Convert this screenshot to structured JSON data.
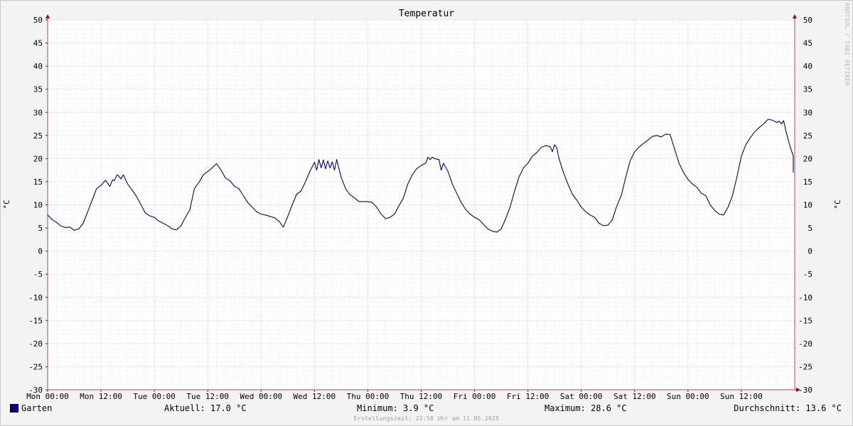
{
  "chart_data": {
    "type": "line",
    "title": "Temperatur",
    "ylabel": "°C",
    "ylim": [
      -30,
      50
    ],
    "yticks": [
      50,
      45,
      40,
      35,
      30,
      25,
      20,
      15,
      10,
      5,
      0,
      -5,
      -10,
      -15,
      -20,
      -25,
      -30
    ],
    "xlim": [
      0,
      168
    ],
    "x_unit": "hours since Mon 00:00",
    "xticks": [
      {
        "x": 0,
        "label": "Mon 00:00"
      },
      {
        "x": 12,
        "label": "Mon 12:00"
      },
      {
        "x": 24,
        "label": "Tue 00:00"
      },
      {
        "x": 36,
        "label": "Tue 12:00"
      },
      {
        "x": 48,
        "label": "Wed 00:00"
      },
      {
        "x": 60,
        "label": "Wed 12:00"
      },
      {
        "x": 72,
        "label": "Thu 00:00"
      },
      {
        "x": 84,
        "label": "Thu 12:00"
      },
      {
        "x": 96,
        "label": "Fri 00:00"
      },
      {
        "x": 108,
        "label": "Fri 12:00"
      },
      {
        "x": 120,
        "label": "Sat 00:00"
      },
      {
        "x": 132,
        "label": "Sat 12:00"
      },
      {
        "x": 144,
        "label": "Sun 00:00"
      },
      {
        "x": 156,
        "label": "Sun 12:00"
      }
    ],
    "grid": true,
    "series": [
      {
        "name": "Garten",
        "color": "#00008b",
        "points": [
          [
            0,
            7.8
          ],
          [
            1,
            6.8
          ],
          [
            2,
            6.2
          ],
          [
            3,
            5.4
          ],
          [
            4,
            5.1
          ],
          [
            5,
            5.2
          ],
          [
            6,
            4.5
          ],
          [
            7,
            4.8
          ],
          [
            8,
            6.0
          ],
          [
            9,
            8.5
          ],
          [
            10,
            11.0
          ],
          [
            11,
            13.5
          ],
          [
            12,
            14.2
          ],
          [
            13,
            15.3
          ],
          [
            14,
            14.0
          ],
          [
            14.6,
            15.4
          ],
          [
            15,
            15.2
          ],
          [
            15.6,
            16.5
          ],
          [
            16,
            16.2
          ],
          [
            16.5,
            15.6
          ],
          [
            17,
            16.5
          ],
          [
            18,
            14.5
          ],
          [
            19,
            13.2
          ],
          [
            20,
            11.8
          ],
          [
            21,
            10.0
          ],
          [
            22,
            8.2
          ],
          [
            23,
            7.6
          ],
          [
            24,
            7.3
          ],
          [
            25,
            6.5
          ],
          [
            26,
            6.0
          ],
          [
            27,
            5.5
          ],
          [
            28,
            4.8
          ],
          [
            29,
            4.6
          ],
          [
            30,
            5.5
          ],
          [
            31,
            7.3
          ],
          [
            32,
            9.0
          ],
          [
            33,
            13.5
          ],
          [
            34,
            14.8
          ],
          [
            35,
            16.5
          ],
          [
            36,
            17.2
          ],
          [
            37,
            18.0
          ],
          [
            38,
            18.9
          ],
          [
            39,
            17.5
          ],
          [
            40,
            15.8
          ],
          [
            41,
            15.2
          ],
          [
            42,
            14.0
          ],
          [
            43,
            13.5
          ],
          [
            44,
            12.0
          ],
          [
            45,
            10.5
          ],
          [
            46,
            9.5
          ],
          [
            47,
            8.5
          ],
          [
            48,
            8.0
          ],
          [
            49,
            7.8
          ],
          [
            50,
            7.5
          ],
          [
            51,
            7.2
          ],
          [
            52,
            6.5
          ],
          [
            53,
            5.2
          ],
          [
            54,
            7.5
          ],
          [
            55,
            10.0
          ],
          [
            56,
            12.3
          ],
          [
            57,
            13.0
          ],
          [
            58,
            15.0
          ],
          [
            59,
            17.3
          ],
          [
            60,
            19.2
          ],
          [
            60.5,
            17.5
          ],
          [
            61,
            19.8
          ],
          [
            61.5,
            18.0
          ],
          [
            62,
            19.7
          ],
          [
            62.5,
            17.8
          ],
          [
            63,
            19.5
          ],
          [
            63.5,
            18.0
          ],
          [
            64,
            19.3
          ],
          [
            64.5,
            17.5
          ],
          [
            65,
            19.8
          ],
          [
            66,
            16.0
          ],
          [
            67,
            13.5
          ],
          [
            68,
            12.2
          ],
          [
            69,
            11.5
          ],
          [
            70,
            10.7
          ],
          [
            71,
            10.7
          ],
          [
            72,
            10.7
          ],
          [
            73,
            10.5
          ],
          [
            74,
            9.5
          ],
          [
            75,
            8.0
          ],
          [
            76,
            7.0
          ],
          [
            77,
            7.3
          ],
          [
            78,
            8.0
          ],
          [
            79,
            9.8
          ],
          [
            80,
            11.5
          ],
          [
            81,
            14.5
          ],
          [
            82,
            16.5
          ],
          [
            83,
            17.8
          ],
          [
            84,
            18.5
          ],
          [
            85,
            19.0
          ],
          [
            85.5,
            20.3
          ],
          [
            86,
            19.8
          ],
          [
            86.5,
            20.3
          ],
          [
            87,
            20.0
          ],
          [
            88,
            19.8
          ],
          [
            88.5,
            17.5
          ],
          [
            89,
            19.0
          ],
          [
            90,
            17.3
          ],
          [
            91,
            14.5
          ],
          [
            92,
            12.5
          ],
          [
            93,
            10.5
          ],
          [
            94,
            9.0
          ],
          [
            95,
            8.0
          ],
          [
            96,
            7.3
          ],
          [
            97,
            6.8
          ],
          [
            98,
            5.8
          ],
          [
            99,
            4.8
          ],
          [
            100,
            4.3
          ],
          [
            101,
            4.1
          ],
          [
            102,
            4.8
          ],
          [
            103,
            7.0
          ],
          [
            104,
            9.5
          ],
          [
            105,
            13.0
          ],
          [
            106,
            16.0
          ],
          [
            107,
            18.0
          ],
          [
            108,
            19.0
          ],
          [
            109,
            20.5
          ],
          [
            110,
            21.3
          ],
          [
            111,
            22.4
          ],
          [
            112,
            22.8
          ],
          [
            113,
            22.6
          ],
          [
            113.5,
            21.5
          ],
          [
            114,
            23.0
          ],
          [
            114.5,
            22.3
          ],
          [
            115,
            20.0
          ],
          [
            116,
            17.0
          ],
          [
            117,
            14.5
          ],
          [
            118,
            12.3
          ],
          [
            119,
            11.0
          ],
          [
            120,
            9.5
          ],
          [
            121,
            8.5
          ],
          [
            122,
            7.8
          ],
          [
            123,
            7.3
          ],
          [
            124,
            6.0
          ],
          [
            125,
            5.5
          ],
          [
            126,
            5.6
          ],
          [
            127,
            6.8
          ],
          [
            128,
            9.8
          ],
          [
            129,
            12.0
          ],
          [
            130,
            16.0
          ],
          [
            131,
            19.5
          ],
          [
            132,
            21.5
          ],
          [
            133,
            22.5
          ],
          [
            134,
            23.3
          ],
          [
            135,
            24.0
          ],
          [
            136,
            24.8
          ],
          [
            137,
            25.0
          ],
          [
            138,
            24.7
          ],
          [
            139,
            25.3
          ],
          [
            140,
            25.2
          ],
          [
            141,
            22.0
          ],
          [
            142,
            19.0
          ],
          [
            143,
            17.0
          ],
          [
            144,
            15.5
          ],
          [
            145,
            14.5
          ],
          [
            146,
            13.8
          ],
          [
            147,
            12.5
          ],
          [
            148,
            12.0
          ],
          [
            149,
            10.0
          ],
          [
            150,
            8.8
          ],
          [
            151,
            8.0
          ],
          [
            152,
            7.8
          ],
          [
            153,
            9.5
          ],
          [
            154,
            12.0
          ],
          [
            155,
            16.0
          ],
          [
            156,
            20.5
          ],
          [
            157,
            23.0
          ],
          [
            158,
            24.5
          ],
          [
            159,
            25.8
          ],
          [
            160,
            26.7
          ],
          [
            161,
            27.5
          ],
          [
            162,
            28.5
          ],
          [
            163,
            28.3
          ],
          [
            164,
            27.8
          ],
          [
            164.5,
            28.1
          ],
          [
            165,
            27.5
          ],
          [
            165.5,
            28.2
          ],
          [
            166,
            26.0
          ],
          [
            167,
            22.5
          ],
          [
            168,
            20.5
          ],
          [
            169,
            19.0
          ],
          [
            170,
            18.0
          ],
          [
            171,
            17.0
          ]
        ]
      }
    ],
    "legend": {
      "series_name": "Garten",
      "aktuell": "Aktuell: 17.0 °C",
      "minimum": "Minimum: 3.9 °C",
      "maximum": "Maximum: 28.6 °C",
      "durchschnitt": "Durchschnitt: 13.6 °C"
    },
    "footer": "Erstellungszeit: 23:58 Uhr am 11.05.2025",
    "watermark": "RRDTOOL / TOBI OETIKER"
  }
}
